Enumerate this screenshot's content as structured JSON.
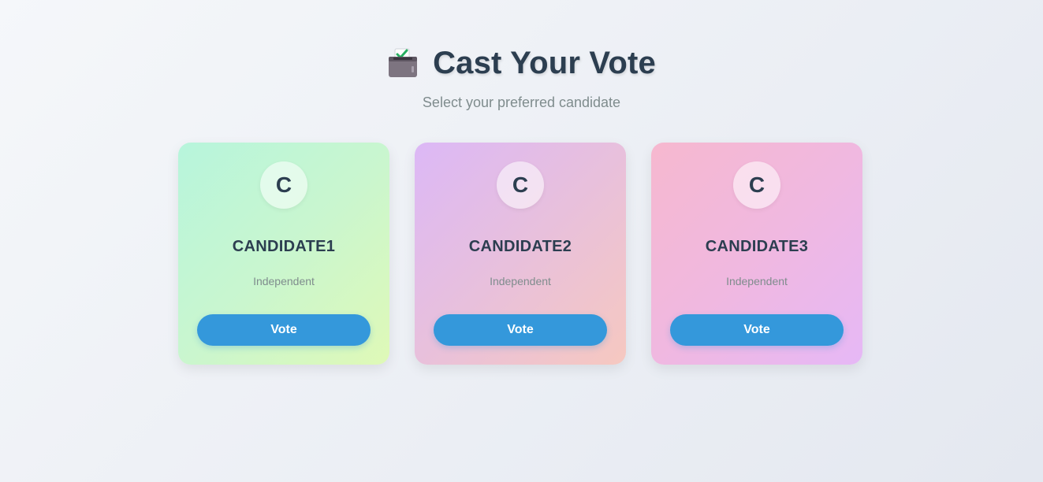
{
  "header": {
    "icon": "ballot-box-icon",
    "title": "Cast Your Vote",
    "subtitle": "Select your preferred candidate"
  },
  "candidates": [
    {
      "initial": "C",
      "name": "CANDIDATE1",
      "party": "Independent",
      "button_label": "Vote",
      "colors": [
        "#b7f5dc",
        "#dff9b7"
      ]
    },
    {
      "initial": "C",
      "name": "CANDIDATE2",
      "party": "Independent",
      "button_label": "Vote",
      "colors": [
        "#dcb8f6",
        "#f6c8c0"
      ]
    },
    {
      "initial": "C",
      "name": "CANDIDATE3",
      "party": "Independent",
      "button_label": "Vote",
      "colors": [
        "#f6b8cf",
        "#e6b8f6"
      ]
    }
  ],
  "theme": {
    "accent": "#3498db",
    "text": "#2c3e50",
    "muted": "#7f8c8d"
  }
}
